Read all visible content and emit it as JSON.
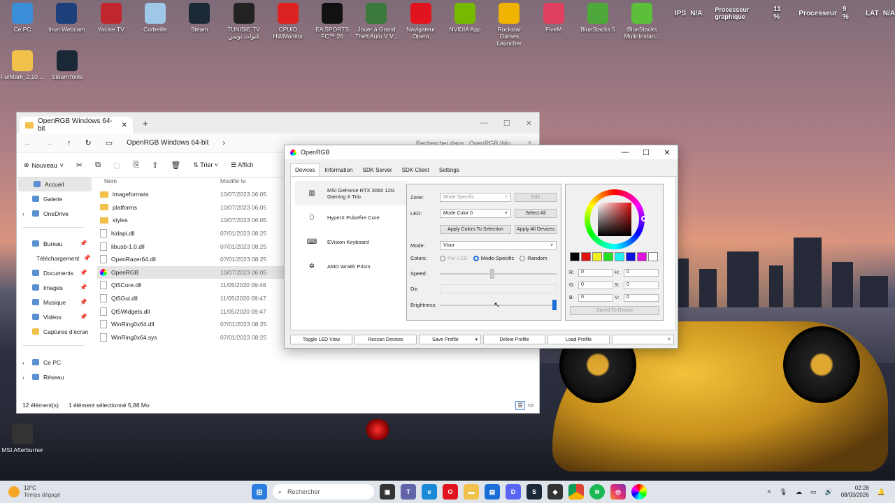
{
  "desktop": {
    "icons_top": [
      {
        "label": "Ce PC",
        "icon": "monitor-icon",
        "color": "#3a8fd8"
      },
      {
        "label": "Inun Webcam",
        "icon": "webcam-icon",
        "color": "#1d3f7a"
      },
      {
        "label": "Yacine TV",
        "icon": "tv-icon",
        "color": "#c0262d"
      },
      {
        "label": "Corbeille",
        "icon": "recycle-bin-icon",
        "color": "#9fc7e8"
      },
      {
        "label": "Steam",
        "icon": "steam-icon",
        "color": "#1b2838"
      },
      {
        "label": "TUNISIE TV قنوات تونس",
        "icon": "live-tv-icon",
        "color": "#222"
      },
      {
        "label": "CPUID HWMonitor",
        "icon": "hwmonitor-icon",
        "color": "#d22"
      },
      {
        "label": "EA SPORTS FC™ 26",
        "icon": "ea-fc-icon",
        "color": "#111"
      },
      {
        "label": "Jouer à Grand Theft Auto V V...",
        "icon": "gta-icon",
        "color": "#3b7a3b"
      },
      {
        "label": "Navigateur Opera",
        "icon": "opera-icon",
        "color": "#e0131e"
      },
      {
        "label": "NVIDIA App",
        "icon": "nvidia-icon",
        "color": "#76b900"
      },
      {
        "label": "Rockstar Games Launcher",
        "icon": "rockstar-icon",
        "color": "#f0b400"
      },
      {
        "label": "FiveM",
        "icon": "fivem-icon",
        "color": "#e04060"
      },
      {
        "label": "BlueStacks 5",
        "icon": "bluestacks-icon",
        "color": "#4fa83a"
      },
      {
        "label": "BlueStacks Multi-Instan...",
        "icon": "bluestacks-multi-icon",
        "color": "#5cbf3a"
      }
    ],
    "icons_left": [
      {
        "label": "FurMark_2.10....",
        "icon": "folder-icon",
        "color": "#f2c14b"
      },
      {
        "label": "SteamTools",
        "icon": "steamtools-icon",
        "color": "#1b2838"
      },
      {
        "label": "MSI Afterburner",
        "icon": "afterburner-icon",
        "color": "#333"
      }
    ]
  },
  "overlay": {
    "ips_label": "IPS",
    "ips_value": "N/A",
    "gpu_label": "Processeur graphique",
    "gpu_value": "11 %",
    "cpu_label": "Processeur",
    "cpu_value": "9 %",
    "lat_label": "LAT",
    "lat_value": "N/A"
  },
  "explorer": {
    "tab_title": "OpenRGB Windows 64-bit",
    "breadcrumb": "OpenRGB Windows 64-bit",
    "search_placeholder": "Rechercher dans : OpenRGB Win",
    "new_label": "Nouveau",
    "sort_label": "Trier",
    "view_label": "Affich",
    "sidebar": [
      {
        "label": "Accueil",
        "icon": "home-icon"
      },
      {
        "label": "Galerie",
        "icon": "gallery-icon"
      },
      {
        "label": "OneDrive",
        "icon": "onedrive-icon"
      },
      {
        "label": "Bureau",
        "icon": "desktop-folder-icon"
      },
      {
        "label": "Téléchargement",
        "icon": "download-icon"
      },
      {
        "label": "Documents",
        "icon": "documents-icon"
      },
      {
        "label": "Images",
        "icon": "images-icon"
      },
      {
        "label": "Musique",
        "icon": "music-icon"
      },
      {
        "label": "Vidéos",
        "icon": "videos-icon"
      },
      {
        "label": "Captures d'écran",
        "icon": "folder-icon"
      },
      {
        "label": "Ce PC",
        "icon": "pc-icon"
      },
      {
        "label": "Réseau",
        "icon": "network-icon"
      }
    ],
    "columns": {
      "name": "Nom",
      "modified": "Modifié le"
    },
    "files": [
      {
        "name": "imageformats",
        "date": "10/07/2023 06:05",
        "type": "folder"
      },
      {
        "name": "platforms",
        "date": "10/07/2023 06:05",
        "type": "folder"
      },
      {
        "name": "styles",
        "date": "10/07/2023 06:05",
        "type": "folder"
      },
      {
        "name": "hidapi.dll",
        "date": "07/01/2023 08:25",
        "type": "file"
      },
      {
        "name": "libusb-1.0.dll",
        "date": "07/01/2023 08:25",
        "type": "file"
      },
      {
        "name": "OpenRazer64.dll",
        "date": "07/01/2023 08:25",
        "type": "file"
      },
      {
        "name": "OpenRGB",
        "date": "10/07/2023 06:05",
        "type": "app"
      },
      {
        "name": "Qt5Core.dll",
        "date": "11/05/2020 09:46",
        "type": "file"
      },
      {
        "name": "Qt5Gui.dll",
        "date": "11/05/2020 09:47",
        "type": "file"
      },
      {
        "name": "Qt5Widgets.dll",
        "date": "11/05/2020 09:47",
        "type": "file"
      },
      {
        "name": "WinRing0x64.dll",
        "date": "07/01/2023 08:25",
        "type": "file"
      },
      {
        "name": "WinRing0x64.sys",
        "date": "07/01/2023 08:25",
        "type": "file"
      }
    ],
    "status_count": "12 élément(s)",
    "status_selected": "1 élément sélectionné  5,88 Mo"
  },
  "openrgb": {
    "title": "OpenRGB",
    "tabs": [
      "Devices",
      "Information",
      "SDK Server",
      "SDK Client",
      "Settings"
    ],
    "devices": [
      {
        "name": "MSI GeForce RTX 3060 12G Gaming X Trio",
        "icon": "gpu-icon"
      },
      {
        "name": "HyperX Pulsefire Core",
        "icon": "mouse-icon"
      },
      {
        "name": "EVision Keyboard",
        "icon": "keyboard-icon"
      },
      {
        "name": "AMD Wraith Prism",
        "icon": "cooler-icon"
      }
    ],
    "zone_label": "Zone:",
    "zone_value": "Mode Specific",
    "edit_label": "Edit",
    "led_label": "LED:",
    "led_value": "Mode Color 0",
    "select_all_label": "Select All",
    "apply_selection_label": "Apply Colors To Selection",
    "apply_all_label": "Apply All Devices",
    "mode_label": "Mode:",
    "mode_value": "Visor",
    "colors_label": "Colors:",
    "per_led_label": "Per-LED",
    "mode_specific_label": "Mode-Specific",
    "random_label": "Random",
    "speed_label": "Speed:",
    "dir_label": "Dir:",
    "brightness_label": "Brightness:",
    "speed_level": 0.45,
    "brightness_level": 1.0,
    "swatches": [
      "#000000",
      "#e01010",
      "#f0f020",
      "#20e020",
      "#20f0f0",
      "#1010e0",
      "#e010e0",
      "#ffffff"
    ],
    "r_label": "R:",
    "r_value": "0",
    "g_label": "G:",
    "g_value": "0",
    "b_label": "B:",
    "b_value": "0",
    "h_label": "H:",
    "h_value": "0",
    "s_label": "S:",
    "s_value": "0",
    "v_label": "V:",
    "v_value": "0",
    "saved_label": "Saved To Device",
    "bottom": {
      "toggle": "Toggle LED View",
      "rescan": "Rescan Devices",
      "save": "Save Profile",
      "delete": "Delete Profile",
      "load": "Load Profile"
    }
  },
  "taskbar": {
    "weather_temp": "13°C",
    "weather_desc": "Temps dégagé",
    "search_placeholder": "Rechercher",
    "time": "02:28",
    "date": "08/03/2026"
  }
}
